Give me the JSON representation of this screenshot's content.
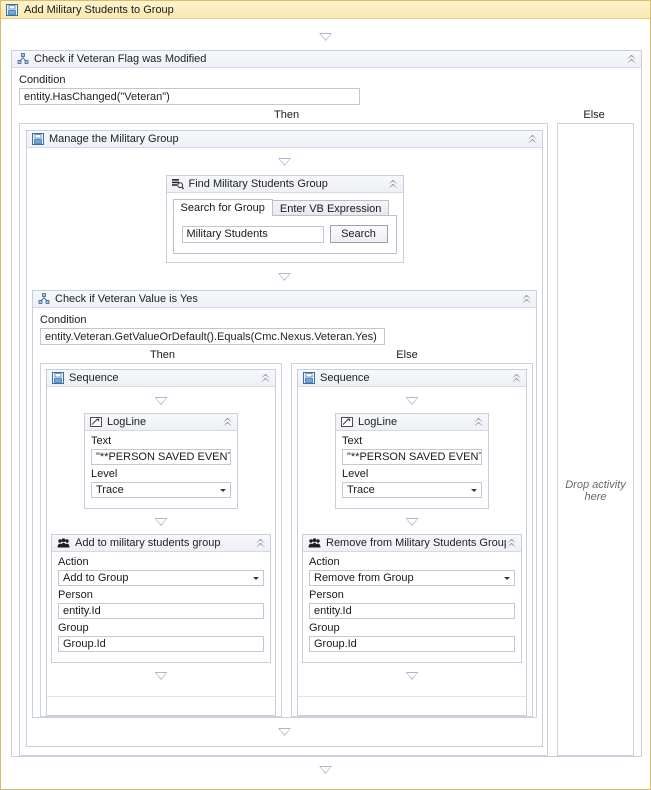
{
  "root": {
    "title": "Add Military Students to Group",
    "icon": "workflow-activity-icon"
  },
  "if_outer": {
    "title": "Check if Veteran Flag was Modified",
    "icon": "if-decision-icon",
    "condition_label": "Condition",
    "condition_value": "entity.HasChanged(\"Veteran\")",
    "then_label": "Then",
    "else_label": "Else",
    "else_dropzone": "Drop activity here"
  },
  "sequence_outer": {
    "title": "Manage the Military Group",
    "icon": "sequence-icon"
  },
  "find_group": {
    "title": "Find Military Students Group",
    "icon": "find-group-icon",
    "tabs": [
      {
        "label": "Search for Group",
        "selected": true
      },
      {
        "label": "Enter VB Expression",
        "selected": false
      }
    ],
    "search_value": "Military Students",
    "search_button": "Search"
  },
  "if_inner": {
    "title": "Check if Veteran Value is Yes",
    "icon": "if-decision-icon",
    "condition_label": "Condition",
    "condition_value": "entity.Veteran.GetValueOrDefault().Equals(Cmc.Nexus.Veteran.Yes)",
    "then_label": "Then",
    "else_label": "Else"
  },
  "then_branch": {
    "sequence": {
      "title": "Sequence",
      "icon": "sequence-icon"
    },
    "logline": {
      "title": "LogLine",
      "icon": "logline-icon",
      "text_label": "Text",
      "text_value": "\"**PERSON SAVED EVENT** - \" & er",
      "level_label": "Level",
      "level_value": "Trace"
    },
    "group_activity": {
      "title": "Add to military students group",
      "icon": "group-people-icon",
      "action_label": "Action",
      "action_value": "Add to Group",
      "person_label": "Person",
      "person_value": "entity.Id",
      "group_label": "Group",
      "group_value": "Group.Id"
    }
  },
  "else_branch": {
    "sequence": {
      "title": "Sequence",
      "icon": "sequence-icon"
    },
    "logline": {
      "title": "LogLine",
      "icon": "logline-icon",
      "text_label": "Text",
      "text_value": "\"**PERSON SAVED EVENT** - \" & er",
      "level_label": "Level",
      "level_value": "Trace"
    },
    "group_activity": {
      "title": "Remove from Military Students Group",
      "icon": "group-people-icon",
      "action_label": "Action",
      "action_value": "Remove from Group",
      "person_label": "Person",
      "person_value": "entity.Id",
      "group_label": "Group",
      "group_value": "Group.Id"
    }
  },
  "colors": {
    "root_border": "#d9be6a",
    "root_header": "#fbe9b0",
    "activity_border": "#c8cedb",
    "activity_header": "#eef0f5",
    "connector": "#aab6ca"
  }
}
